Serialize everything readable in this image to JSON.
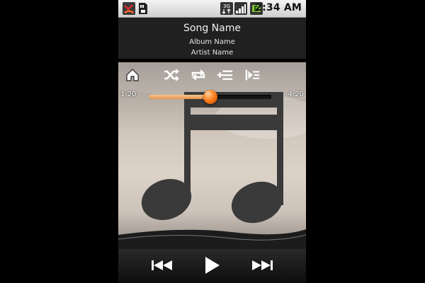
{
  "status_bar": {
    "time": "2:34 AM",
    "left_icons": [
      "missed-call-icon",
      "sd-card-icon"
    ],
    "right_icons": [
      "3g-icon",
      "signal-icon",
      "battery-icon"
    ],
    "network_label": "3G"
  },
  "track": {
    "song": "Song Name",
    "album": "Album Name",
    "artist": "Artist Name"
  },
  "controls": {
    "top": [
      "home-icon",
      "shuffle-icon",
      "repeat-icon",
      "add-to-playlist-icon",
      "queue-icon"
    ],
    "bottom": [
      "previous-icon",
      "play-icon",
      "next-icon"
    ]
  },
  "progress": {
    "elapsed": "1:20",
    "total": "4:20",
    "fraction": 0.5
  },
  "colors": {
    "accent": "#ff8a2a",
    "seek_fill": "#e8a060",
    "art_background": "#d6ccc2",
    "note_color": "#3a3a3a"
  }
}
